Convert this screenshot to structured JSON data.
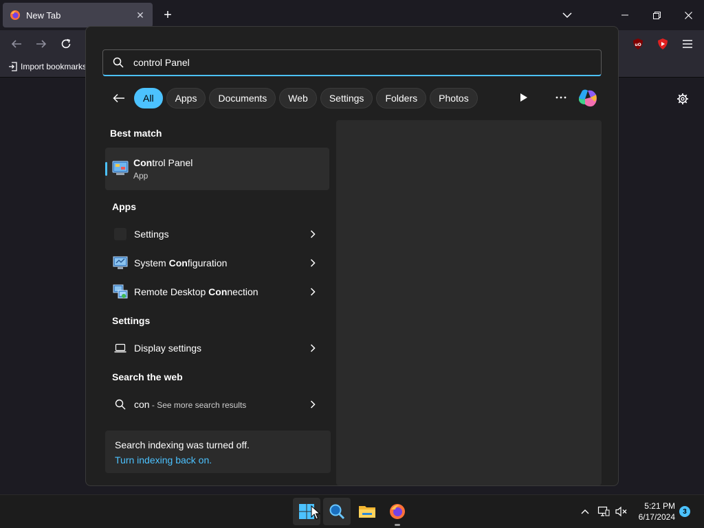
{
  "browser": {
    "tab_title": "New Tab",
    "bookmark_import": "Import bookmarks..."
  },
  "search": {
    "query": "control Panel",
    "filters": [
      "All",
      "Apps",
      "Documents",
      "Web",
      "Settings",
      "Folders",
      "Photos"
    ],
    "active_filter": "All"
  },
  "results": {
    "best_match_label": "Best match",
    "best_match": {
      "name_bold": "Con",
      "name_rest": "trol Panel",
      "type": "App"
    },
    "apps_label": "Apps",
    "apps": [
      {
        "pre": "Settings",
        "bold": "",
        "post": ""
      },
      {
        "pre": "System ",
        "bold": "Con",
        "post": "figuration"
      },
      {
        "pre": "Remote Desktop ",
        "bold": "Con",
        "post": "nection"
      }
    ],
    "settings_label": "Settings",
    "settings_item": "Display settings",
    "web_label": "Search the web",
    "web_item": {
      "term": "con",
      "suffix": " - See more search results"
    }
  },
  "indexing": {
    "message": "Search indexing was turned off.",
    "link": "Turn indexing back on."
  },
  "taskbar": {
    "time": "5:21 PM",
    "date": "6/17/2024",
    "notification_count": "3"
  },
  "colors": {
    "accent": "#4cc2ff",
    "panel_bg": "#202020",
    "browser_bg": "#1c1b22"
  }
}
